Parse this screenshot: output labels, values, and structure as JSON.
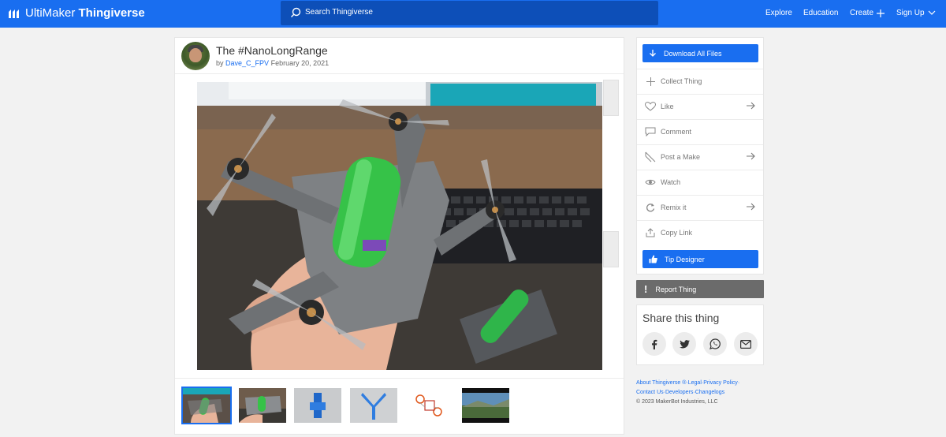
{
  "header": {
    "logo_word1": "UltiMaker",
    "logo_word2": "Thingiverse",
    "search_placeholder": "Search Thingiverse",
    "nav": [
      {
        "label": "Explore"
      },
      {
        "label": "Education"
      },
      {
        "label": "Create"
      },
      {
        "label": "Sign Up"
      }
    ],
    "brand_color": "#196ef0"
  },
  "thing": {
    "title": "The #NanoLongRange",
    "by": "by",
    "author": "Dave_C_FPV",
    "date": "February 20, 2021"
  },
  "thumbnails": [
    {
      "name": "drone-in-hand",
      "selected": true
    },
    {
      "name": "drone-on-desk",
      "selected": false
    },
    {
      "name": "blue-part-1",
      "selected": false
    },
    {
      "name": "blue-part-2",
      "selected": false
    },
    {
      "name": "orange-diagram",
      "selected": false
    },
    {
      "name": "video-landscape",
      "selected": false
    }
  ],
  "sidebar": {
    "download_label": "Download All Files",
    "actions": [
      {
        "label": "Collect Thing",
        "icon": "plus-icon",
        "arrow": false
      },
      {
        "label": "Like",
        "icon": "heart-icon",
        "arrow": true
      },
      {
        "label": "Comment",
        "icon": "comment-icon",
        "arrow": false
      },
      {
        "label": "Post a Make",
        "icon": "make-icon",
        "arrow": true
      },
      {
        "label": "Watch",
        "icon": "eye-icon",
        "arrow": false
      },
      {
        "label": "Remix it",
        "icon": "remix-icon",
        "arrow": true
      },
      {
        "label": "Copy Link",
        "icon": "share-link-icon",
        "arrow": false
      }
    ],
    "tip_label": "Tip Designer",
    "report_label": "Report Thing",
    "share_title": "Share this thing",
    "share_buttons": [
      "facebook-icon",
      "twitter-icon",
      "whatsapp-icon",
      "email-icon"
    ]
  },
  "footer": {
    "line1": [
      "About Thingiverse ®",
      "Legal",
      "Privacy Policy"
    ],
    "line2": [
      "Contact Us",
      "Developers",
      "Changelogs"
    ],
    "copyright": "© 2023 MakerBot Industries, LLC"
  }
}
